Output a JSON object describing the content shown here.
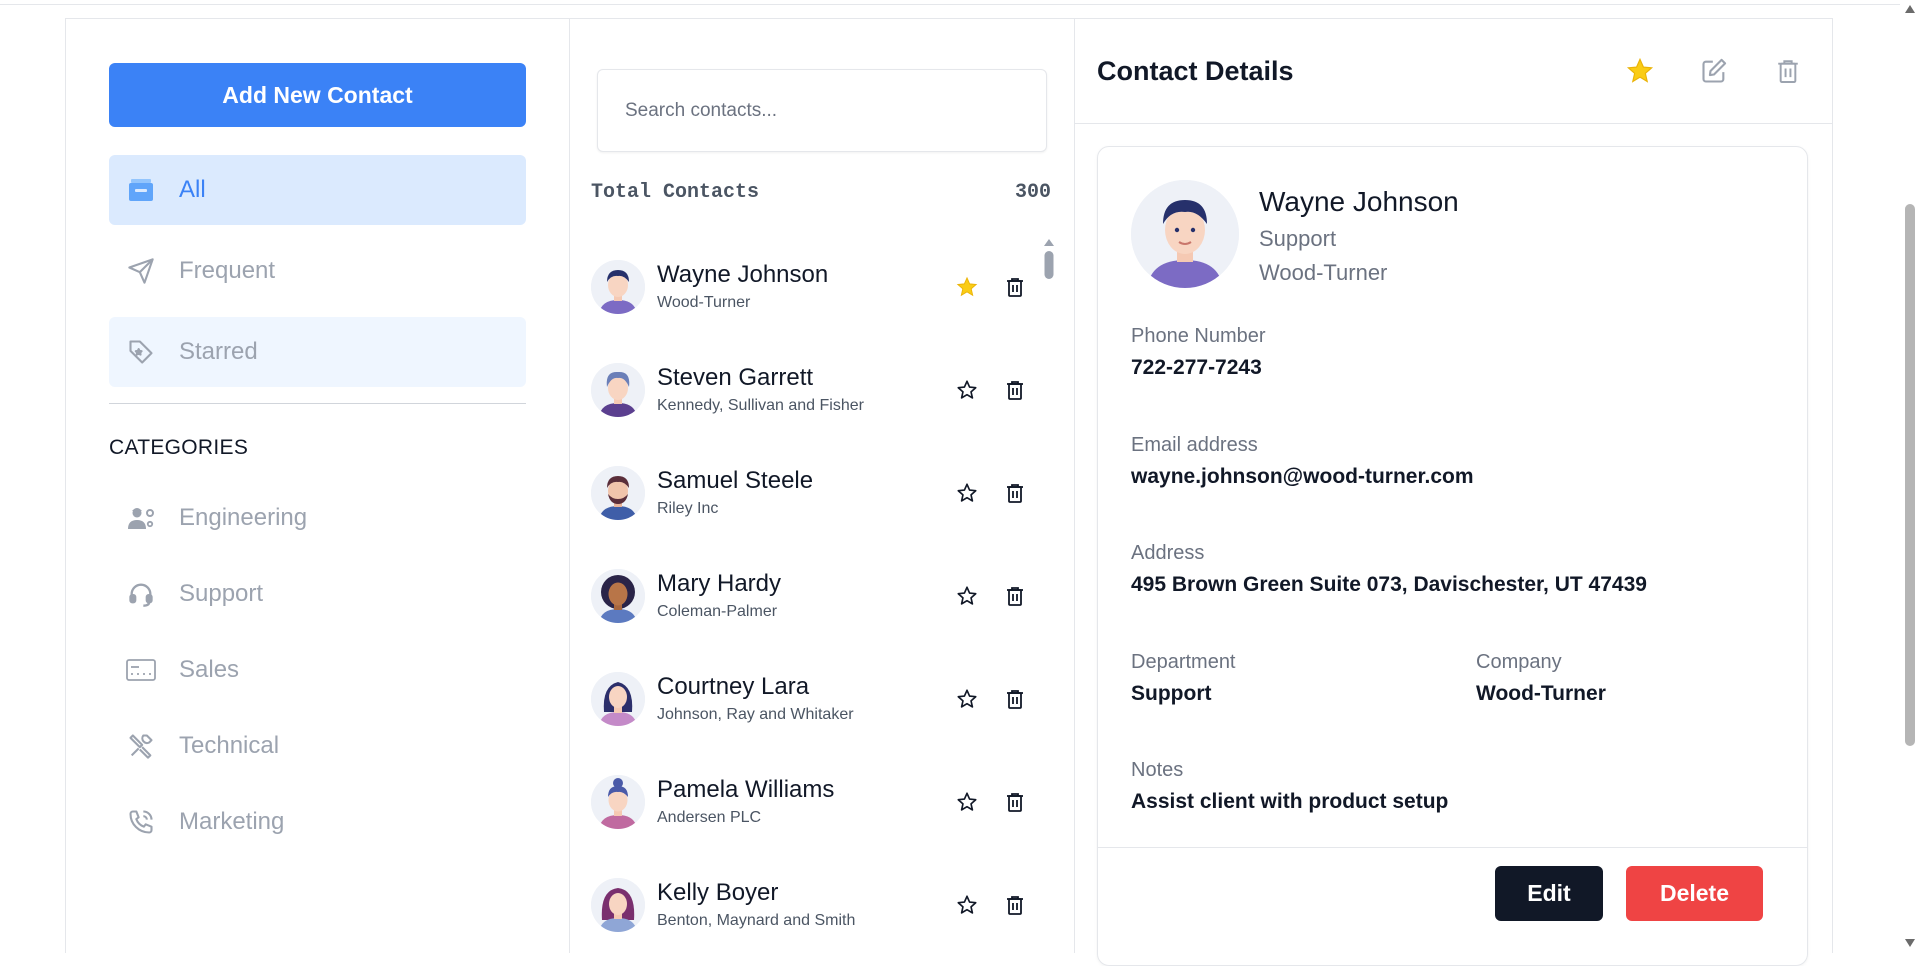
{
  "sidebar": {
    "add_button": "Add New Contact",
    "nav": [
      {
        "label": "All",
        "icon": "inbox-icon"
      },
      {
        "label": "Frequent",
        "icon": "send-icon"
      },
      {
        "label": "Starred",
        "icon": "tag-star-icon"
      }
    ],
    "categories_title": "CATEGORIES",
    "categories": [
      {
        "label": "Engineering",
        "icon": "engineer-icon"
      },
      {
        "label": "Support",
        "icon": "headset-icon"
      },
      {
        "label": "Sales",
        "icon": "card-icon"
      },
      {
        "label": "Technical",
        "icon": "tools-icon"
      },
      {
        "label": "Marketing",
        "icon": "phone-icon"
      }
    ]
  },
  "list": {
    "search_placeholder": "Search contacts...",
    "total_label": "Total Contacts",
    "total_count": "300",
    "contacts": [
      {
        "name": "Wayne Johnson",
        "company": "Wood-Turner",
        "starred": true
      },
      {
        "name": "Steven Garrett",
        "company": "Kennedy, Sullivan and Fisher",
        "starred": false
      },
      {
        "name": "Samuel Steele",
        "company": "Riley Inc",
        "starred": false
      },
      {
        "name": "Mary Hardy",
        "company": "Coleman-Palmer",
        "starred": false
      },
      {
        "name": "Courtney Lara",
        "company": "Johnson, Ray and Whitaker",
        "starred": false
      },
      {
        "name": "Pamela Williams",
        "company": "Andersen PLC",
        "starred": false
      },
      {
        "name": "Kelly Boyer",
        "company": "Benton, Maynard and Smith",
        "starred": false
      }
    ]
  },
  "details": {
    "header_title": "Contact Details",
    "name": "Wayne Johnson",
    "department": "Support",
    "company": "Wood-Turner",
    "phone_label": "Phone Number",
    "phone": "722-277-7243",
    "email_label": "Email address",
    "email": "wayne.johnson@wood-turner.com",
    "address_label": "Address",
    "address": "495 Brown Green Suite 073, Davischester, UT 47439",
    "department_label": "Department",
    "company_label": "Company",
    "notes_label": "Notes",
    "notes": "Assist client with product setup",
    "edit_button": "Edit",
    "delete_button": "Delete"
  },
  "colors": {
    "accent": "#3b82f6",
    "star": "#facc15",
    "danger": "#ef4444",
    "dark": "#111827"
  }
}
